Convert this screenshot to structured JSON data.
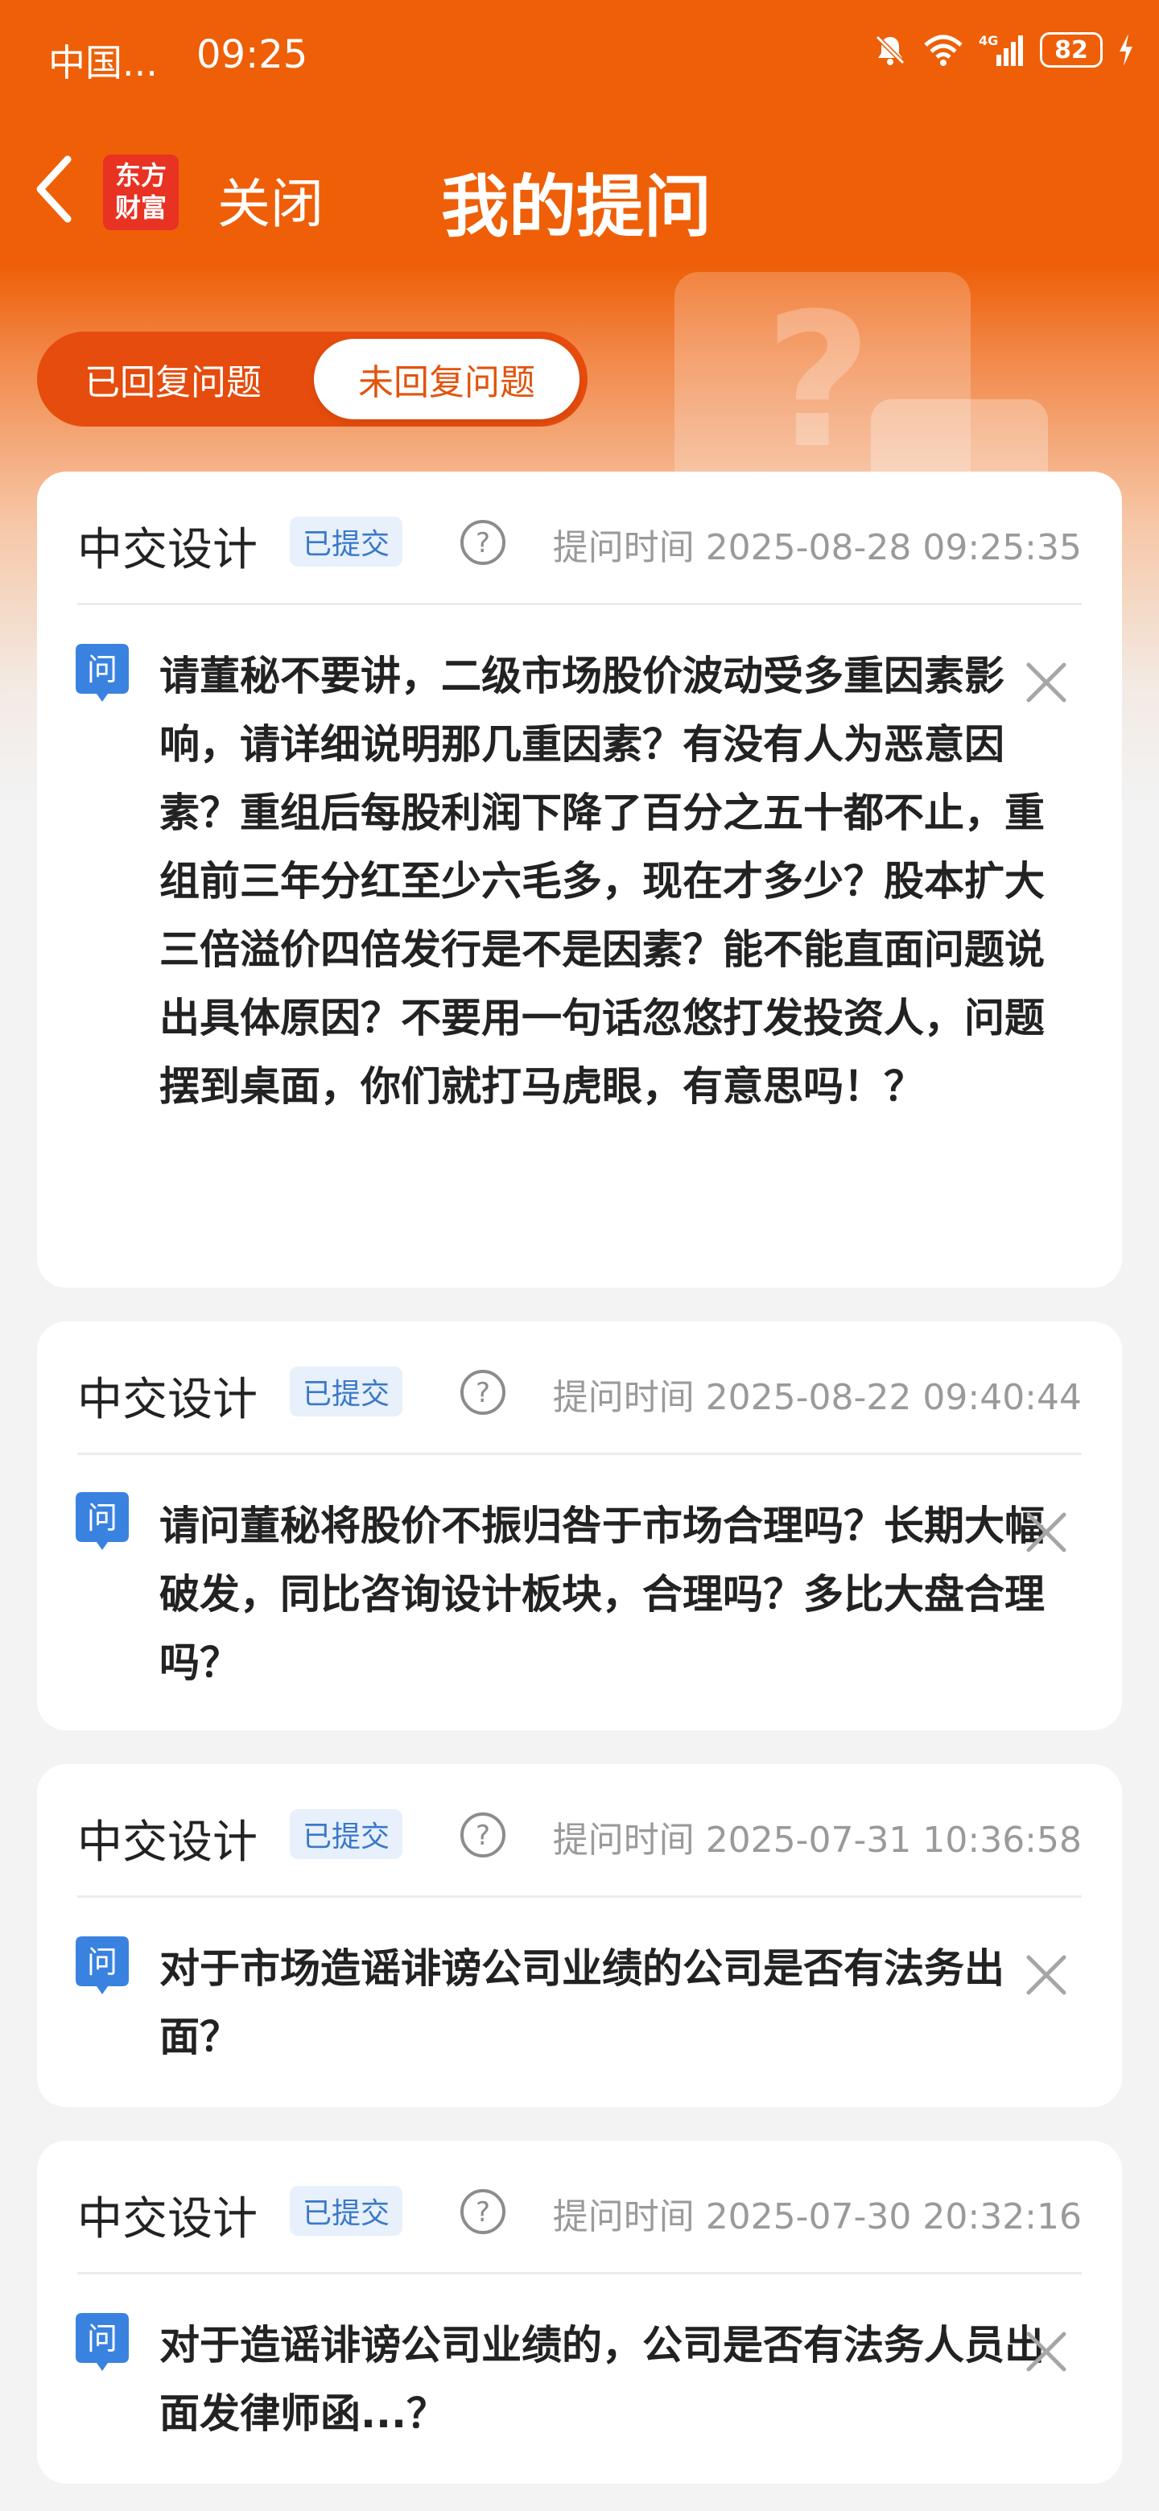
{
  "status_bar": {
    "carrier": "中国...",
    "time": "09:25",
    "battery": "82",
    "network": "4G"
  },
  "nav": {
    "back_icon": "chevron-left-icon",
    "logo_text": [
      "东方",
      "财富"
    ],
    "close_label": "关闭",
    "title": "我的提问"
  },
  "tabs": [
    {
      "label": "已回复问题",
      "selected": false
    },
    {
      "label": "未回复问题",
      "selected": true
    }
  ],
  "questions": [
    {
      "company": "中交设计",
      "status": "已提交",
      "time_label": "提问时间 2025-08-28 09:25:35",
      "badge": "问",
      "text": "请董秘不要讲，二级市场股价波动受多重因素影响，请详细说明那几重因素？有没有人为恶意因素？重组后每股利润下降了百分之五十都不止，重组前三年分红至少六毛多，现在才多少？股本扩大三倍溢价四倍发行是不是因素？能不能直面问题说出具体原因？不要用一句话忽悠打发投资人，问题摆到桌面，你们就打马虎眼，有意思吗！？"
    },
    {
      "company": "中交设计",
      "status": "已提交",
      "time_label": "提问时间 2025-08-22 09:40:44",
      "badge": "问",
      "text": "请问董秘将股价不振归咎于市场合理吗？长期大幅破发，同比咨询设计板块，合理吗？多比大盘合理吗？"
    },
    {
      "company": "中交设计",
      "status": "已提交",
      "time_label": "提问时间 2025-07-31 10:36:58",
      "badge": "问",
      "text": "对于市场造谣诽谤公司业绩的公司是否有法务出面？"
    },
    {
      "company": "中交设计",
      "status": "已提交",
      "time_label": "提问时间 2025-07-30 20:32:16",
      "badge": "问",
      "text": "对于造谣诽谤公司业绩的，公司是否有法务人员出面发律师函...？"
    }
  ],
  "colors": {
    "brand_orange": "#ee5f08",
    "tab_active_text": "#e2540d",
    "badge_blue": "#3a82e0"
  }
}
